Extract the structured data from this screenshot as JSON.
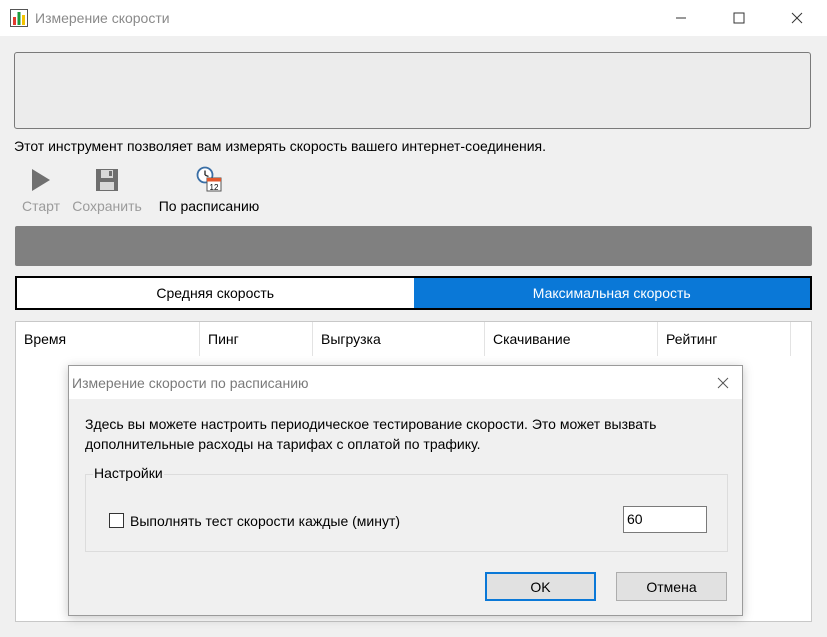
{
  "window": {
    "title": "Измерение скорости",
    "icon": "bar-chart-icon"
  },
  "description": "Этот инструмент позволяет вам измерять скорость вашего интернет-соединения.",
  "toolbar": {
    "start_label": "Старт",
    "save_label": "Сохранить",
    "schedule_label": "По расписанию",
    "schedule_icon_number": "12"
  },
  "tabs": {
    "average": "Средняя скорость",
    "maximum": "Максимальная скорость"
  },
  "table": {
    "columns": [
      "Время",
      "Пинг",
      "Выгрузка",
      "Скачивание",
      "Рейтинг"
    ]
  },
  "dialog": {
    "title": "Измерение скорости по расписанию",
    "message": "Здесь вы можете настроить периодическое тестирование скорости. Это может вызвать дополнительные расходы на тарифах с оплатой по трафику.",
    "group_title": "Настройки",
    "checkbox_label": "Выполнять тест скорости каждые (минут)",
    "checkbox_checked": false,
    "interval_value": "60",
    "ok_label": "OK",
    "cancel_label": "Отмена"
  },
  "colors": {
    "accent": "#0a78d7",
    "progress": "#808080"
  }
}
